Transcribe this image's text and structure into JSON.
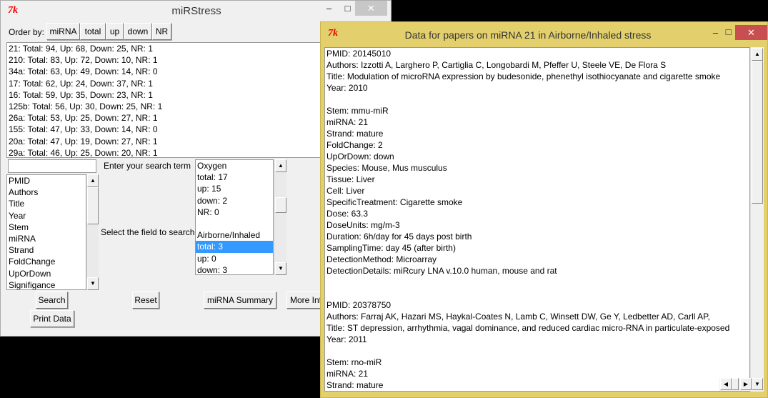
{
  "main_window": {
    "title": "miRStress",
    "order_by_label": "Order by:",
    "order_buttons": [
      "miRNA",
      "total",
      "up",
      "down",
      "NR"
    ],
    "results": [
      "21: Total: 94, Up: 68, Down: 25, NR: 1",
      "210: Total: 83, Up: 72, Down: 10, NR: 1",
      "34a: Total: 63, Up: 49, Down: 14, NR: 0",
      "17: Total: 62, Up: 24, Down: 37, NR: 1",
      "16: Total: 59, Up: 35, Down: 23, NR: 1",
      "125b: Total: 56, Up: 30, Down: 25, NR: 1",
      "26a: Total: 53, Up: 25, Down: 27, NR: 1",
      "155: Total: 47, Up: 33, Down: 14, NR: 0",
      "20a: Total: 47, Up: 19, Down: 27, NR: 1",
      "29a: Total: 46, Up: 25, Down: 20, NR: 1"
    ],
    "search_value": "",
    "search_label": "Enter your search term",
    "field_label": "Select the field to search",
    "fields": [
      "PMID",
      "Authors",
      "Title",
      "Year",
      "Stem",
      "miRNA",
      "Strand",
      "FoldChange",
      "UpOrDown",
      "Signifigance"
    ],
    "stress_list": [
      "Oxygen",
      "total: 17",
      "up: 15",
      "down: 2",
      "NR: 0",
      "",
      "Airborne/Inhaled",
      "total: 3",
      "up: 0",
      "down: 3"
    ],
    "stress_selected_index": 7,
    "buttons": {
      "search": "Search",
      "reset": "Reset",
      "summary": "miRNA Summary",
      "more_info": "More Info",
      "print": "Print Data"
    }
  },
  "data_window": {
    "title": "Data for papers on miRNA 21 in Airborne/Inhaled stress",
    "lines": [
      "PMID: 20145010",
      "Authors: Izzotti A, Larghero P, Cartiglia C, Longobardi M, Pfeffer U, Steele VE, De Flora S",
      "Title: Modulation of microRNA expression by budesonide, phenethyl isothiocyanate and cigarette smoke",
      "Year: 2010",
      "",
      "Stem: mmu-miR",
      "miRNA: 21",
      "Strand: mature",
      "FoldChange: 2",
      "UpOrDown: down",
      "Species: Mouse, Mus musculus",
      "Tissue: Liver",
      "Cell: Liver",
      "SpecificTreatment: Cigarette smoke",
      "Dose: 63.3",
      "DoseUnits: mg/m-3",
      "Duration: 6h/day for 45 days post birth",
      "SamplingTime: day 45 (after birth)",
      "DetectionMethod: Microarray",
      "DetectionDetails: miRcury LNA v.10.0 human, mouse and rat",
      "",
      "",
      "PMID: 20378750",
      "Authors: Farraj AK,  Hazari MS,  Haykal-Coates N,  Lamb C,  Winsett DW,  Ge Y,  Ledbetter AD,  Carll AP,",
      "Title: ST depression, arrhythmia, vagal dominance, and reduced cardiac micro-RNA in particulate-exposed",
      "Year: 2011",
      "",
      "Stem: rno-miR",
      "miRNA: 21",
      "Strand: mature"
    ]
  }
}
